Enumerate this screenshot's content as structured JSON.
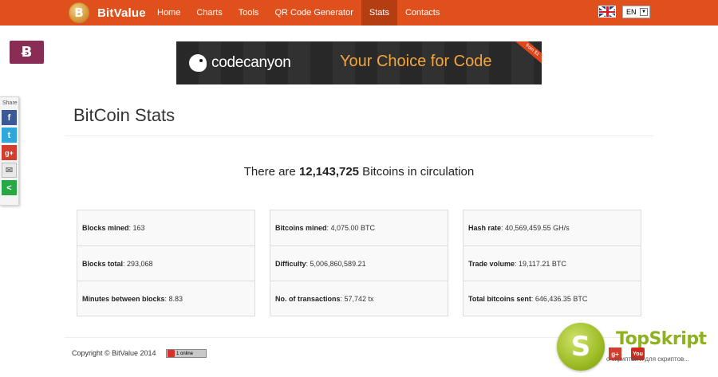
{
  "brand": {
    "name": "BitValue",
    "logo_glyph": "B"
  },
  "nav": {
    "items": [
      {
        "label": "Home",
        "active": false
      },
      {
        "label": "Charts",
        "active": false
      },
      {
        "label": "Tools",
        "active": false
      },
      {
        "label": "QR Code Generator",
        "active": false
      },
      {
        "label": "Stats",
        "active": true
      },
      {
        "label": "Contacts",
        "active": false
      }
    ]
  },
  "language": {
    "selected": "EN",
    "flag_icon": "uk-flag-icon"
  },
  "sidebar_badge": {
    "glyph": "Ƀ"
  },
  "share": {
    "label": "Share",
    "buttons": [
      {
        "icon": "facebook-icon",
        "glyph": "f"
      },
      {
        "icon": "twitter-icon",
        "glyph": "t"
      },
      {
        "icon": "google-plus-icon",
        "glyph": "g+"
      },
      {
        "icon": "email-icon",
        "glyph": "✉"
      },
      {
        "icon": "share-icon",
        "glyph": "<"
      }
    ]
  },
  "banner": {
    "brand": "codecanyon",
    "tagline": "Your Choice for Code",
    "ribbon": "from $1"
  },
  "page": {
    "title": "BitCoin Stats",
    "circulation_prefix": "There are ",
    "circulation_value": "12,143,725",
    "circulation_suffix": " Bitcoins in circulation"
  },
  "stats": {
    "col1": [
      {
        "label": "Blocks mined",
        "value": ": 163"
      },
      {
        "label": "Blocks total",
        "value": ": 293,068"
      },
      {
        "label": "Minutes between blocks",
        "value": ": 8.83"
      }
    ],
    "col2": [
      {
        "label": "Bitcoins mined",
        "value": ": 4,075.00 BTC"
      },
      {
        "label": "Difficulty",
        "value": ": 5,006,860,589.21"
      },
      {
        "label": "No. of transactions",
        "value": ": 57,742 tx"
      }
    ],
    "col3": [
      {
        "label": "Hash rate",
        "value": ": 40,569,459.55 GH/s"
      },
      {
        "label": "Trade volume",
        "value": ": 19,117.21 BTC"
      },
      {
        "label": "Total bitcoins sent",
        "value": ": 646,436.35 BTC"
      }
    ]
  },
  "footer": {
    "copyright": "Copyright © BitValue 2014",
    "counter_text": "1 online"
  },
  "watermark": {
    "glyph": "S",
    "title": "TopSkript",
    "subtitle": "о скриптах и для скриптов...",
    "gplus": "g+",
    "youtube": "You"
  },
  "colors": {
    "navbar": "#e0501c",
    "nav_active": "#b43d12",
    "badge": "#8a2d55"
  }
}
